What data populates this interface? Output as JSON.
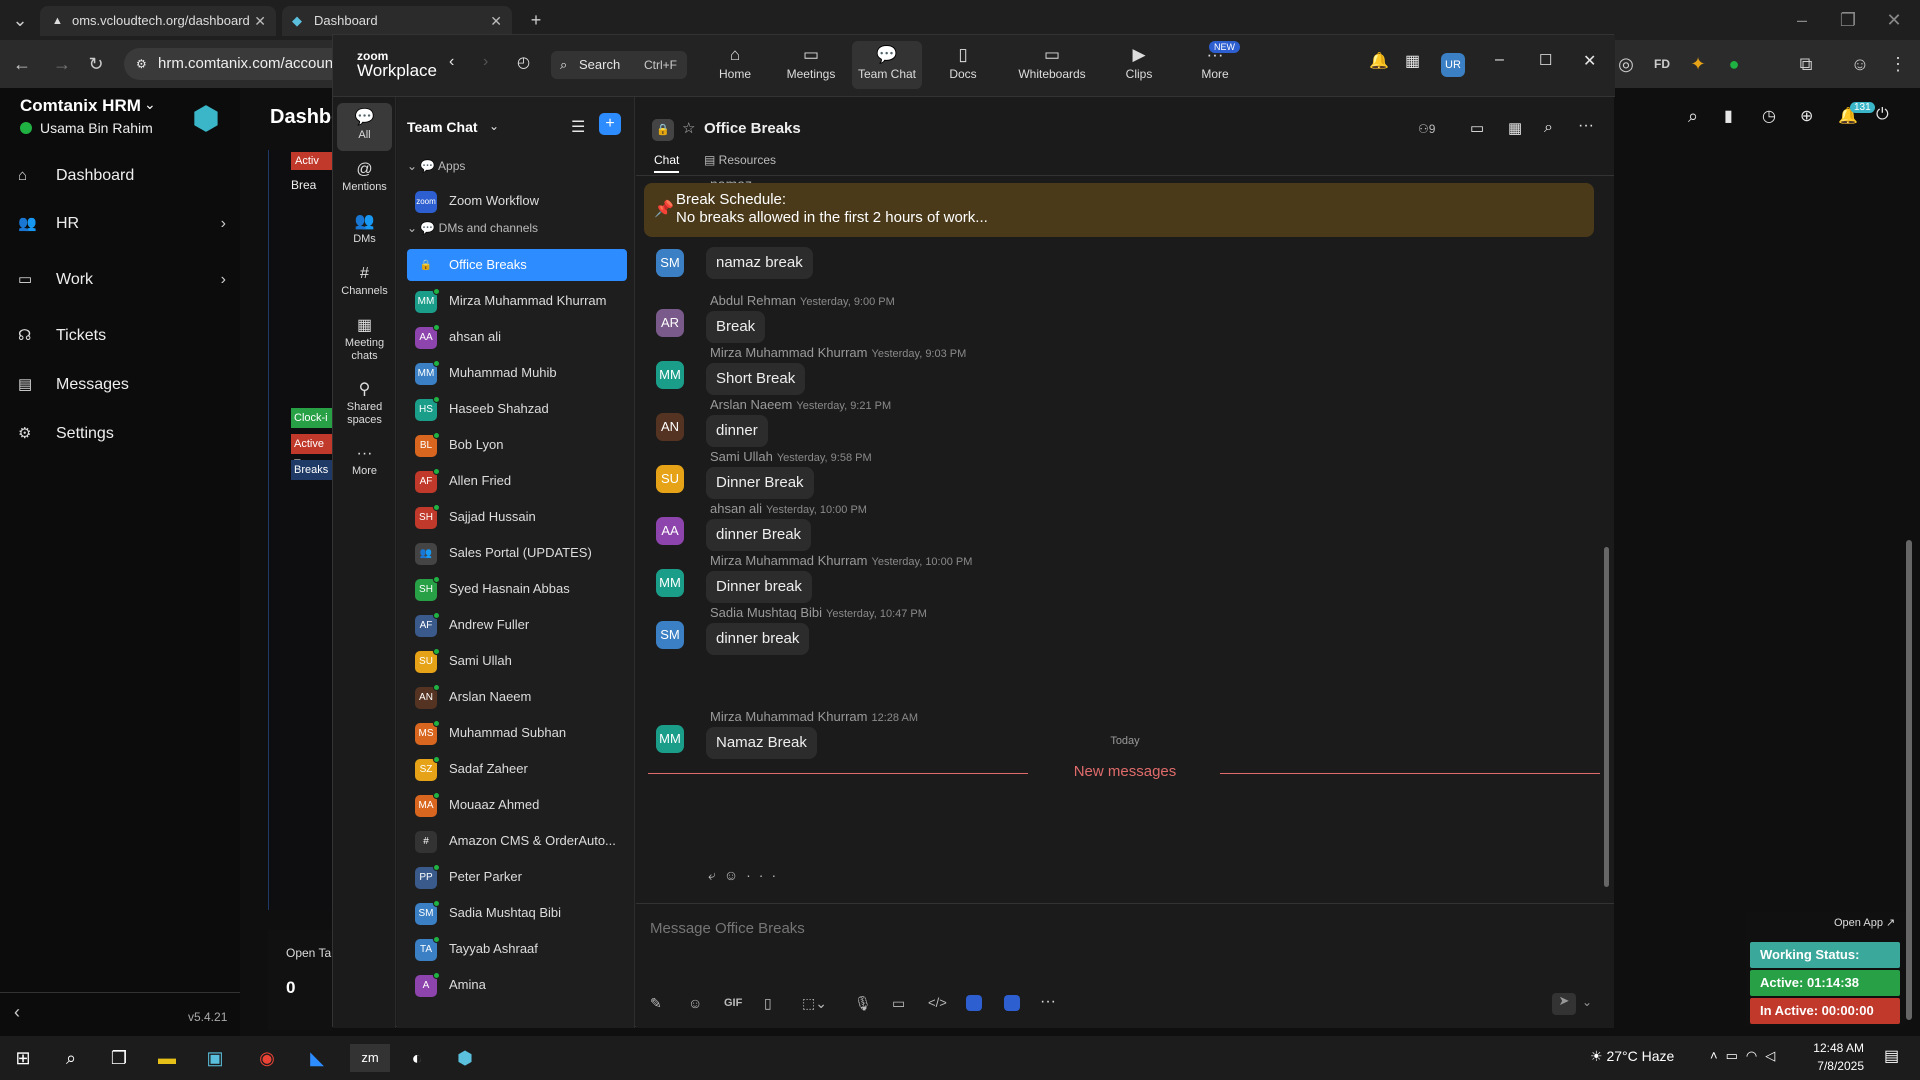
{
  "browser": {
    "tabs": [
      {
        "label": "oms.vcloudtech.org/dashboard"
      },
      {
        "label": "Dashboard"
      }
    ],
    "url": "hrm.comtanix.com/account/"
  },
  "hrm": {
    "brand": "Comtanix HRM",
    "user": "Usama Bin Rahim",
    "page_title": "Dashbo",
    "version": "v5.4.21",
    "open_tasks_label": "Open Ta",
    "open_tasks_value": "0",
    "notif_count": "131",
    "menu": [
      {
        "label": "Dashboard",
        "icon": "home-icon"
      },
      {
        "label": "HR",
        "icon": "users-icon"
      },
      {
        "label": "Work",
        "icon": "briefcase-icon"
      },
      {
        "label": "Tickets",
        "icon": "headset-icon"
      },
      {
        "label": "Messages",
        "icon": "chat-icon"
      },
      {
        "label": "Settings",
        "icon": "gear-icon"
      }
    ],
    "badges": [
      "Activ",
      "Brea",
      "Clock-i",
      "Active T",
      "Breaks"
    ]
  },
  "zoom": {
    "logo_top": "zoom",
    "logo_bottom": "Workplace",
    "search": "Search",
    "search_shortcut": "Ctrl+F",
    "user_initials": "UR",
    "nav": [
      {
        "label": "Home",
        "icon": "home-icon"
      },
      {
        "label": "Meetings",
        "icon": "video-icon"
      },
      {
        "label": "Team Chat",
        "icon": "chat-icon"
      },
      {
        "label": "Docs",
        "icon": "doc-icon"
      },
      {
        "label": "Whiteboards",
        "icon": "whiteboard-icon"
      },
      {
        "label": "Clips",
        "icon": "clips-icon"
      },
      {
        "label": "More",
        "icon": "more-icon",
        "badge": "NEW"
      }
    ],
    "rail": [
      {
        "label": "All"
      },
      {
        "label": "Mentions"
      },
      {
        "label": "DMs"
      },
      {
        "label": "Channels"
      },
      {
        "label": "Meeting chats"
      },
      {
        "label": "Shared spaces"
      },
      {
        "label": "More"
      }
    ],
    "list_title": "Team Chat",
    "apps_label": "Apps",
    "workflow": "Zoom Workflow",
    "dms_label": "DMs and channels",
    "channels": [
      {
        "name": "Office Breaks",
        "ini": "🔒",
        "color": "#2d8cff",
        "active": true
      },
      {
        "name": "Mirza Muhammad Khurram",
        "ini": "MM",
        "color": "#1a9e8a"
      },
      {
        "name": "ahsan ali",
        "ini": "AA",
        "color": "#8e44ad"
      },
      {
        "name": "Muhammad Muhib",
        "ini": "MM",
        "color": "#3b7fc4"
      },
      {
        "name": "Haseeb Shahzad",
        "ini": "HS",
        "color": "#1a9e8a"
      },
      {
        "name": "Bob Lyon",
        "ini": "BL",
        "color": "#d9661f"
      },
      {
        "name": "Allen Fried",
        "ini": "AF",
        "color": "#c0392b"
      },
      {
        "name": "Sajjad Hussain",
        "ini": "SH",
        "color": "#c0392b"
      },
      {
        "name": "Sales Portal (UPDATES)",
        "ini": "👥",
        "color": "#444"
      },
      {
        "name": "Syed Hasnain Abbas",
        "ini": "SH",
        "color": "#27a046"
      },
      {
        "name": "Andrew Fuller",
        "ini": "AF",
        "color": "#3a5a8c"
      },
      {
        "name": "Sami Ullah",
        "ini": "SU",
        "color": "#e6a317"
      },
      {
        "name": "Arslan Naeem",
        "ini": "AN",
        "color": "#553322"
      },
      {
        "name": "Muhammad Subhan",
        "ini": "MS",
        "color": "#d9661f"
      },
      {
        "name": "Sadaf Zaheer",
        "ini": "SZ",
        "color": "#e6a317"
      },
      {
        "name": "Mouaaz Ahmed",
        "ini": "MA",
        "color": "#d9661f"
      },
      {
        "name": "Amazon CMS & OrderAuto...",
        "ini": "#",
        "color": "#333"
      },
      {
        "name": "Peter Parker",
        "ini": "PP",
        "color": "#3a5a8c"
      },
      {
        "name": "Sadia Mushtaq Bibi",
        "ini": "SM",
        "color": "#3b7fc4"
      },
      {
        "name": "Tayyab Ashraaf",
        "ini": "TA",
        "color": "#3b7fc4"
      },
      {
        "name": "Amina",
        "ini": "A",
        "color": "#8e44ad"
      }
    ],
    "chat_title": "Office Breaks",
    "members": "9",
    "tab_chat": "Chat",
    "tab_resources": "Resources",
    "pinned_title": "Break Schedule:",
    "pinned_text": "No breaks allowed in the first 2 hours of work...",
    "top_partial": "namaz",
    "messages": [
      {
        "name": "",
        "time": "",
        "text": "namaz break",
        "ini": "SM",
        "color": "#3b7fc4"
      },
      {
        "name": "Abdul Rehman",
        "time": "Yesterday, 9:00 PM",
        "text": "Break",
        "ini": "AR",
        "color": "#7a5a8a"
      },
      {
        "name": "Mirza Muhammad Khurram",
        "time": "Yesterday, 9:03 PM",
        "text": "Short Break",
        "ini": "MM",
        "color": "#1a9e8a"
      },
      {
        "name": "Arslan Naeem",
        "time": "Yesterday, 9:21 PM",
        "text": "dinner",
        "ini": "AN",
        "color": "#553322"
      },
      {
        "name": "Sami Ullah",
        "time": "Yesterday, 9:58 PM",
        "text": "Dinner Break",
        "ini": "SU",
        "color": "#e6a317"
      },
      {
        "name": "ahsan ali",
        "time": "Yesterday, 10:00 PM",
        "text": "dinner Break",
        "ini": "AA",
        "color": "#8e44ad"
      },
      {
        "name": "Mirza Muhammad Khurram",
        "time": "Yesterday, 10:00 PM",
        "text": "Dinner break",
        "ini": "MM",
        "color": "#1a9e8a"
      },
      {
        "name": "Sadia Mushtaq Bibi",
        "time": "Yesterday, 10:47 PM",
        "text": "dinner break",
        "ini": "SM",
        "color": "#3b7fc4"
      },
      {
        "name": "Mirza Muhammad Khurram",
        "time": "12:28 AM",
        "text": "Namaz Break",
        "ini": "MM",
        "color": "#1a9e8a"
      }
    ],
    "today": "Today",
    "new_messages": "New messages",
    "composer_placeholder": "Message Office Breaks",
    "gif": "GIF"
  },
  "status_widget": {
    "open_app": "Open App ↗",
    "working": "Working Status: Active",
    "active": "Active: 01:14:38",
    "inactive": "In Active: 00:00:00"
  },
  "taskbar": {
    "weather": "27°C  Haze",
    "time": "12:48 AM",
    "date": "7/8/2025"
  }
}
